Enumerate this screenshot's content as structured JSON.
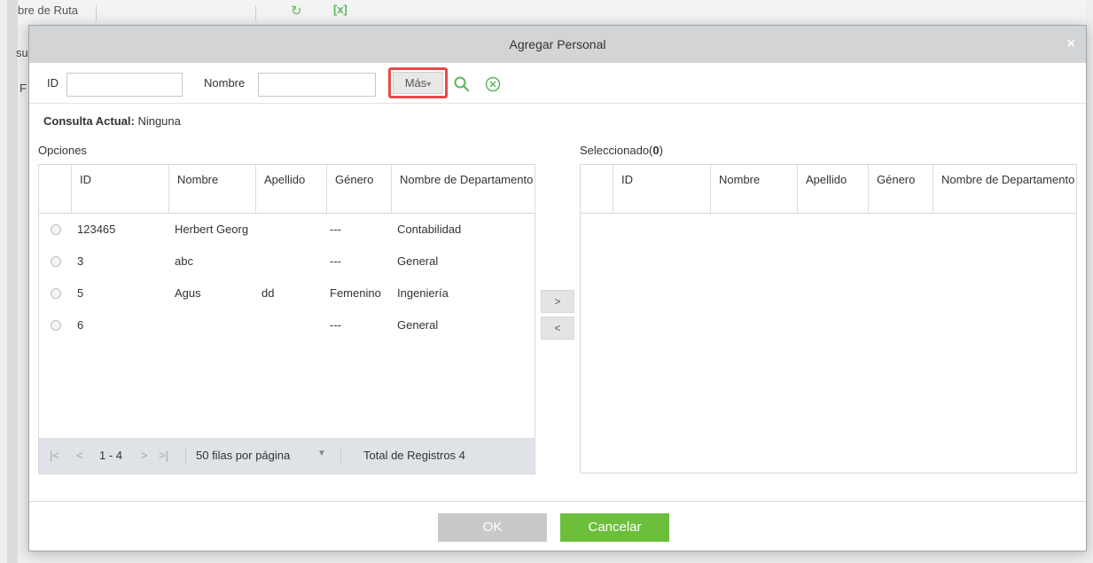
{
  "background": {
    "top_label": "bre de Ruta",
    "edge_text_1": "su",
    "edge_text_2": "F"
  },
  "dialog": {
    "title": "Agregar Personal",
    "close_glyph": "×",
    "filter": {
      "id_label": "ID",
      "id_value": "",
      "name_label": "Nombre",
      "name_value": "",
      "more_label": "Más",
      "more_caret": "▾"
    },
    "consulta": {
      "label": "Consulta Actual:",
      "value": "Ninguna"
    },
    "options": {
      "label": "Opciones",
      "columns": [
        "ID",
        "Nombre",
        "Apellido",
        "Género",
        "Nombre de Departamento"
      ],
      "rows": [
        {
          "id": "123465",
          "nombre": "Herbert Georg",
          "apellido": "",
          "genero": "---",
          "departamento": "Contabilidad"
        },
        {
          "id": "3",
          "nombre": "abc",
          "apellido": "",
          "genero": "---",
          "departamento": "General"
        },
        {
          "id": "5",
          "nombre": "Agus",
          "apellido": "dd",
          "genero": "Femenino",
          "departamento": "Ingeniería"
        },
        {
          "id": "6",
          "nombre": "",
          "apellido": "",
          "genero": "---",
          "departamento": "General"
        }
      ],
      "pager": {
        "first": "|<",
        "prev": "<",
        "range": "1 - 4",
        "next": ">",
        "last": ">|",
        "page_size": "50 filas por página",
        "total": "Total de Registros 4"
      }
    },
    "selected": {
      "label_prefix": "Seleccionado(",
      "count": "0",
      "label_suffix": ")",
      "columns": [
        "ID",
        "Nombre",
        "Apellido",
        "Género",
        "Nombre de Departamento"
      ]
    },
    "move_right": ">",
    "move_left": "<",
    "ok_label": "OK",
    "cancel_label": "Cancelar"
  },
  "colors": {
    "accent_green": "#6bbf3b",
    "highlight_red": "#e84a4a",
    "disabled_gray": "#c9c9c9"
  }
}
